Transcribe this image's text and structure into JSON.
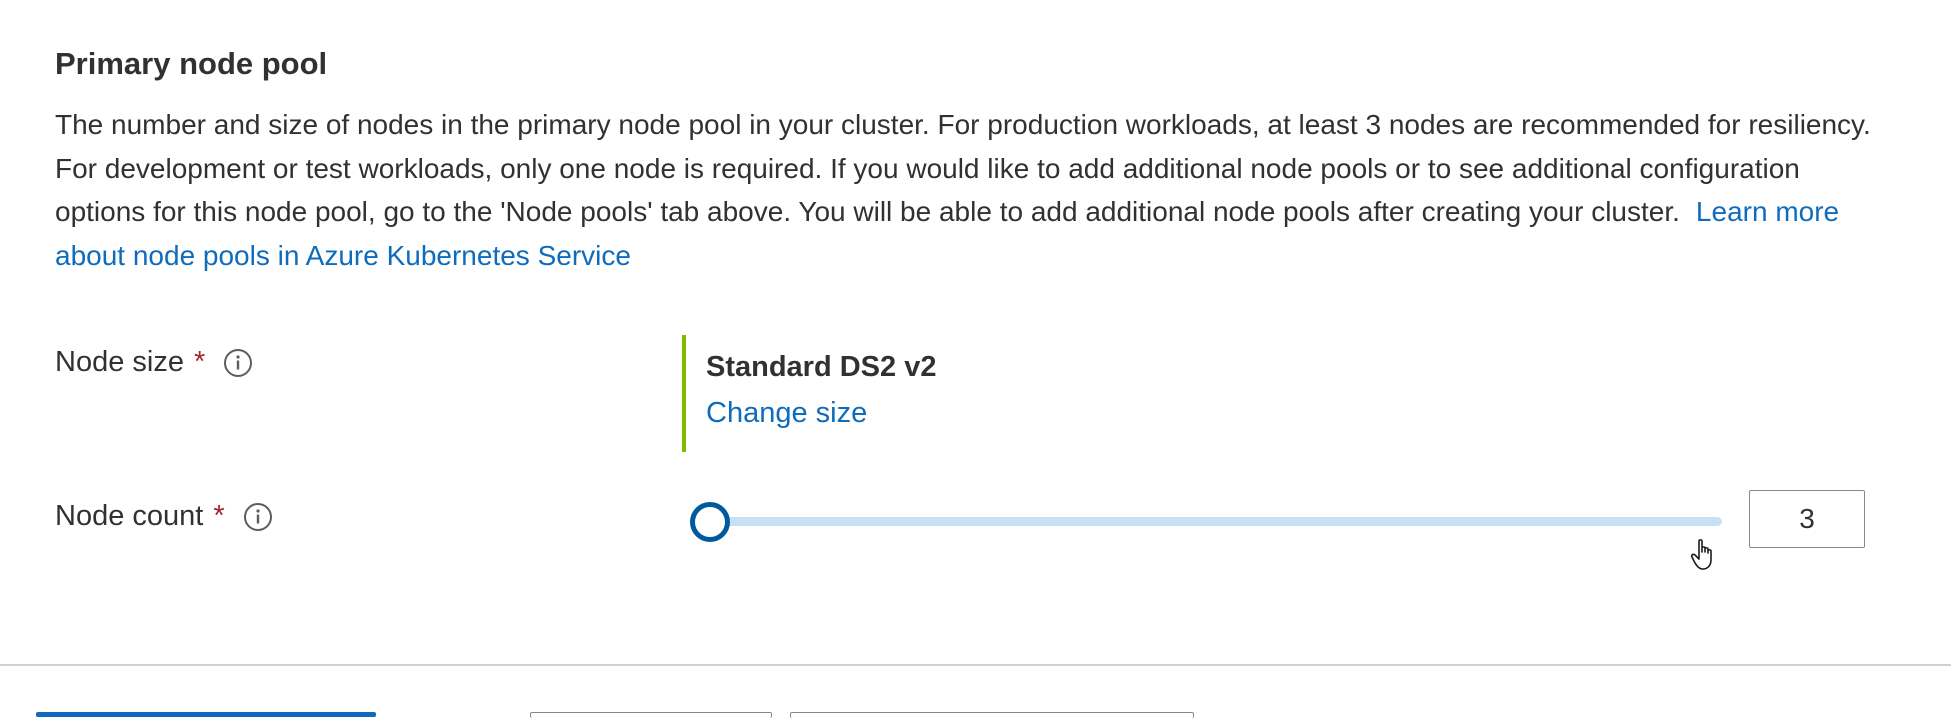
{
  "section": {
    "title": "Primary node pool",
    "description": "The number and size of nodes in the primary node pool in your cluster. For production workloads, at least 3 nodes are recommended for resiliency. For development or test workloads, only one node is required. If you would like to add additional node pools or to see additional configuration options for this node pool, go to the 'Node pools' tab above. You will be able to add additional node pools after creating your cluster.",
    "learn_more_link": "Learn more about node pools in Azure Kubernetes Service"
  },
  "node_size": {
    "label": "Node size",
    "required_marker": "*",
    "info_icon": "info-icon",
    "value": "Standard DS2 v2",
    "change_link": "Change size",
    "accent_color": "#7fba00"
  },
  "node_count": {
    "label": "Node count",
    "required_marker": "*",
    "info_icon": "info-icon",
    "value": "3",
    "slider_fraction": 0.0
  },
  "colors": {
    "link": "#0f6cbd",
    "required": "#a4262c",
    "slider_track": "#c7e0f4",
    "slider_thumb_border": "#005a9e"
  }
}
